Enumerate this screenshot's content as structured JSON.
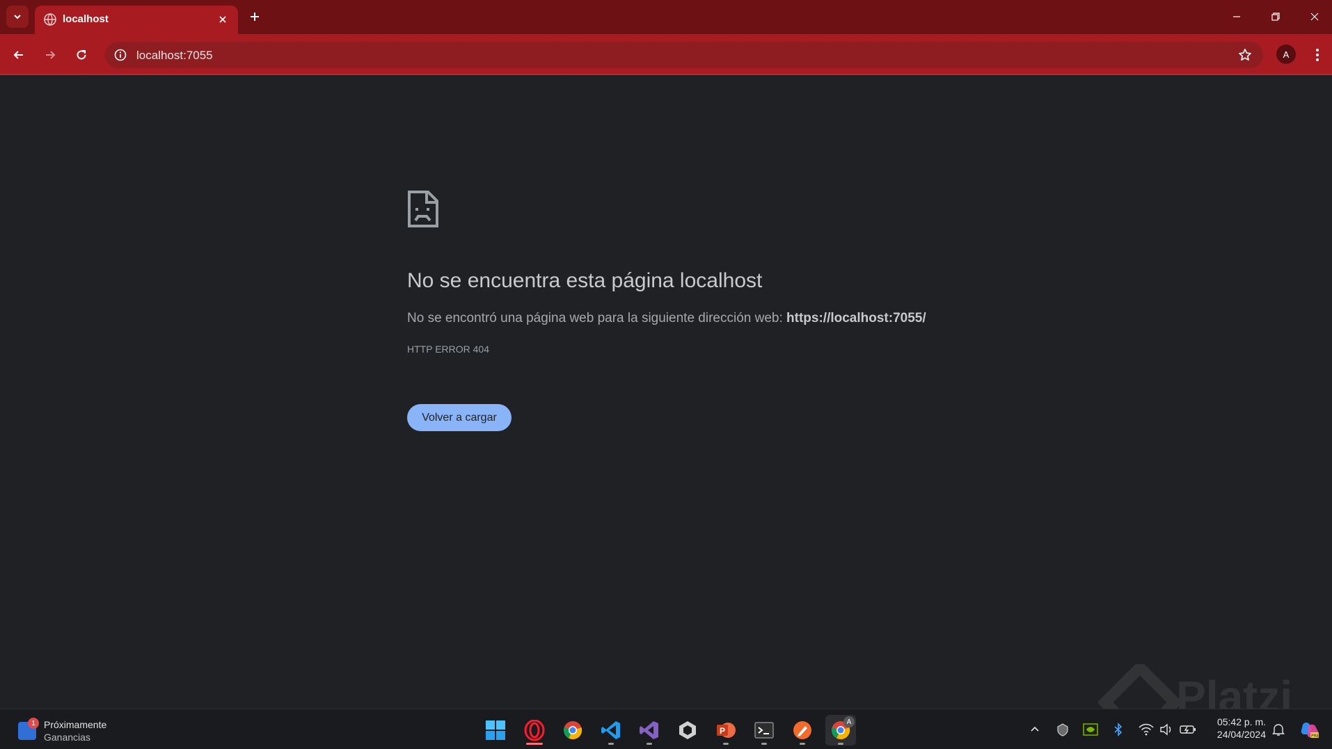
{
  "browser": {
    "tab_title": "localhost",
    "url": "localhost:7055",
    "profile_initial": "A",
    "accent_color": "#a81c21"
  },
  "error_page": {
    "title": "No se encuentra esta página localhost",
    "description_prefix": "No se encontró una página web para la siguiente dirección web: ",
    "description_url": "https://localhost:7055/",
    "error_code": "HTTP ERROR 404",
    "reload_label": "Volver a cargar",
    "button_color": "#8ab4f8"
  },
  "watermark": "Platzi",
  "taskbar": {
    "widget": {
      "badge": "1",
      "line1": "Próximamente",
      "line2": "Ganancias"
    },
    "apps": [
      "windows-start-icon",
      "opera-icon",
      "chrome-icon",
      "vscode-icon",
      "visual-studio-icon",
      "unity-icon",
      "powerpoint-icon",
      "terminal-icon",
      "pen-app-icon",
      "chrome-profile-icon"
    ],
    "chrome_profile_badge": "A",
    "clock": {
      "time": "05:42 p. m.",
      "date": "24/04/2024"
    }
  }
}
